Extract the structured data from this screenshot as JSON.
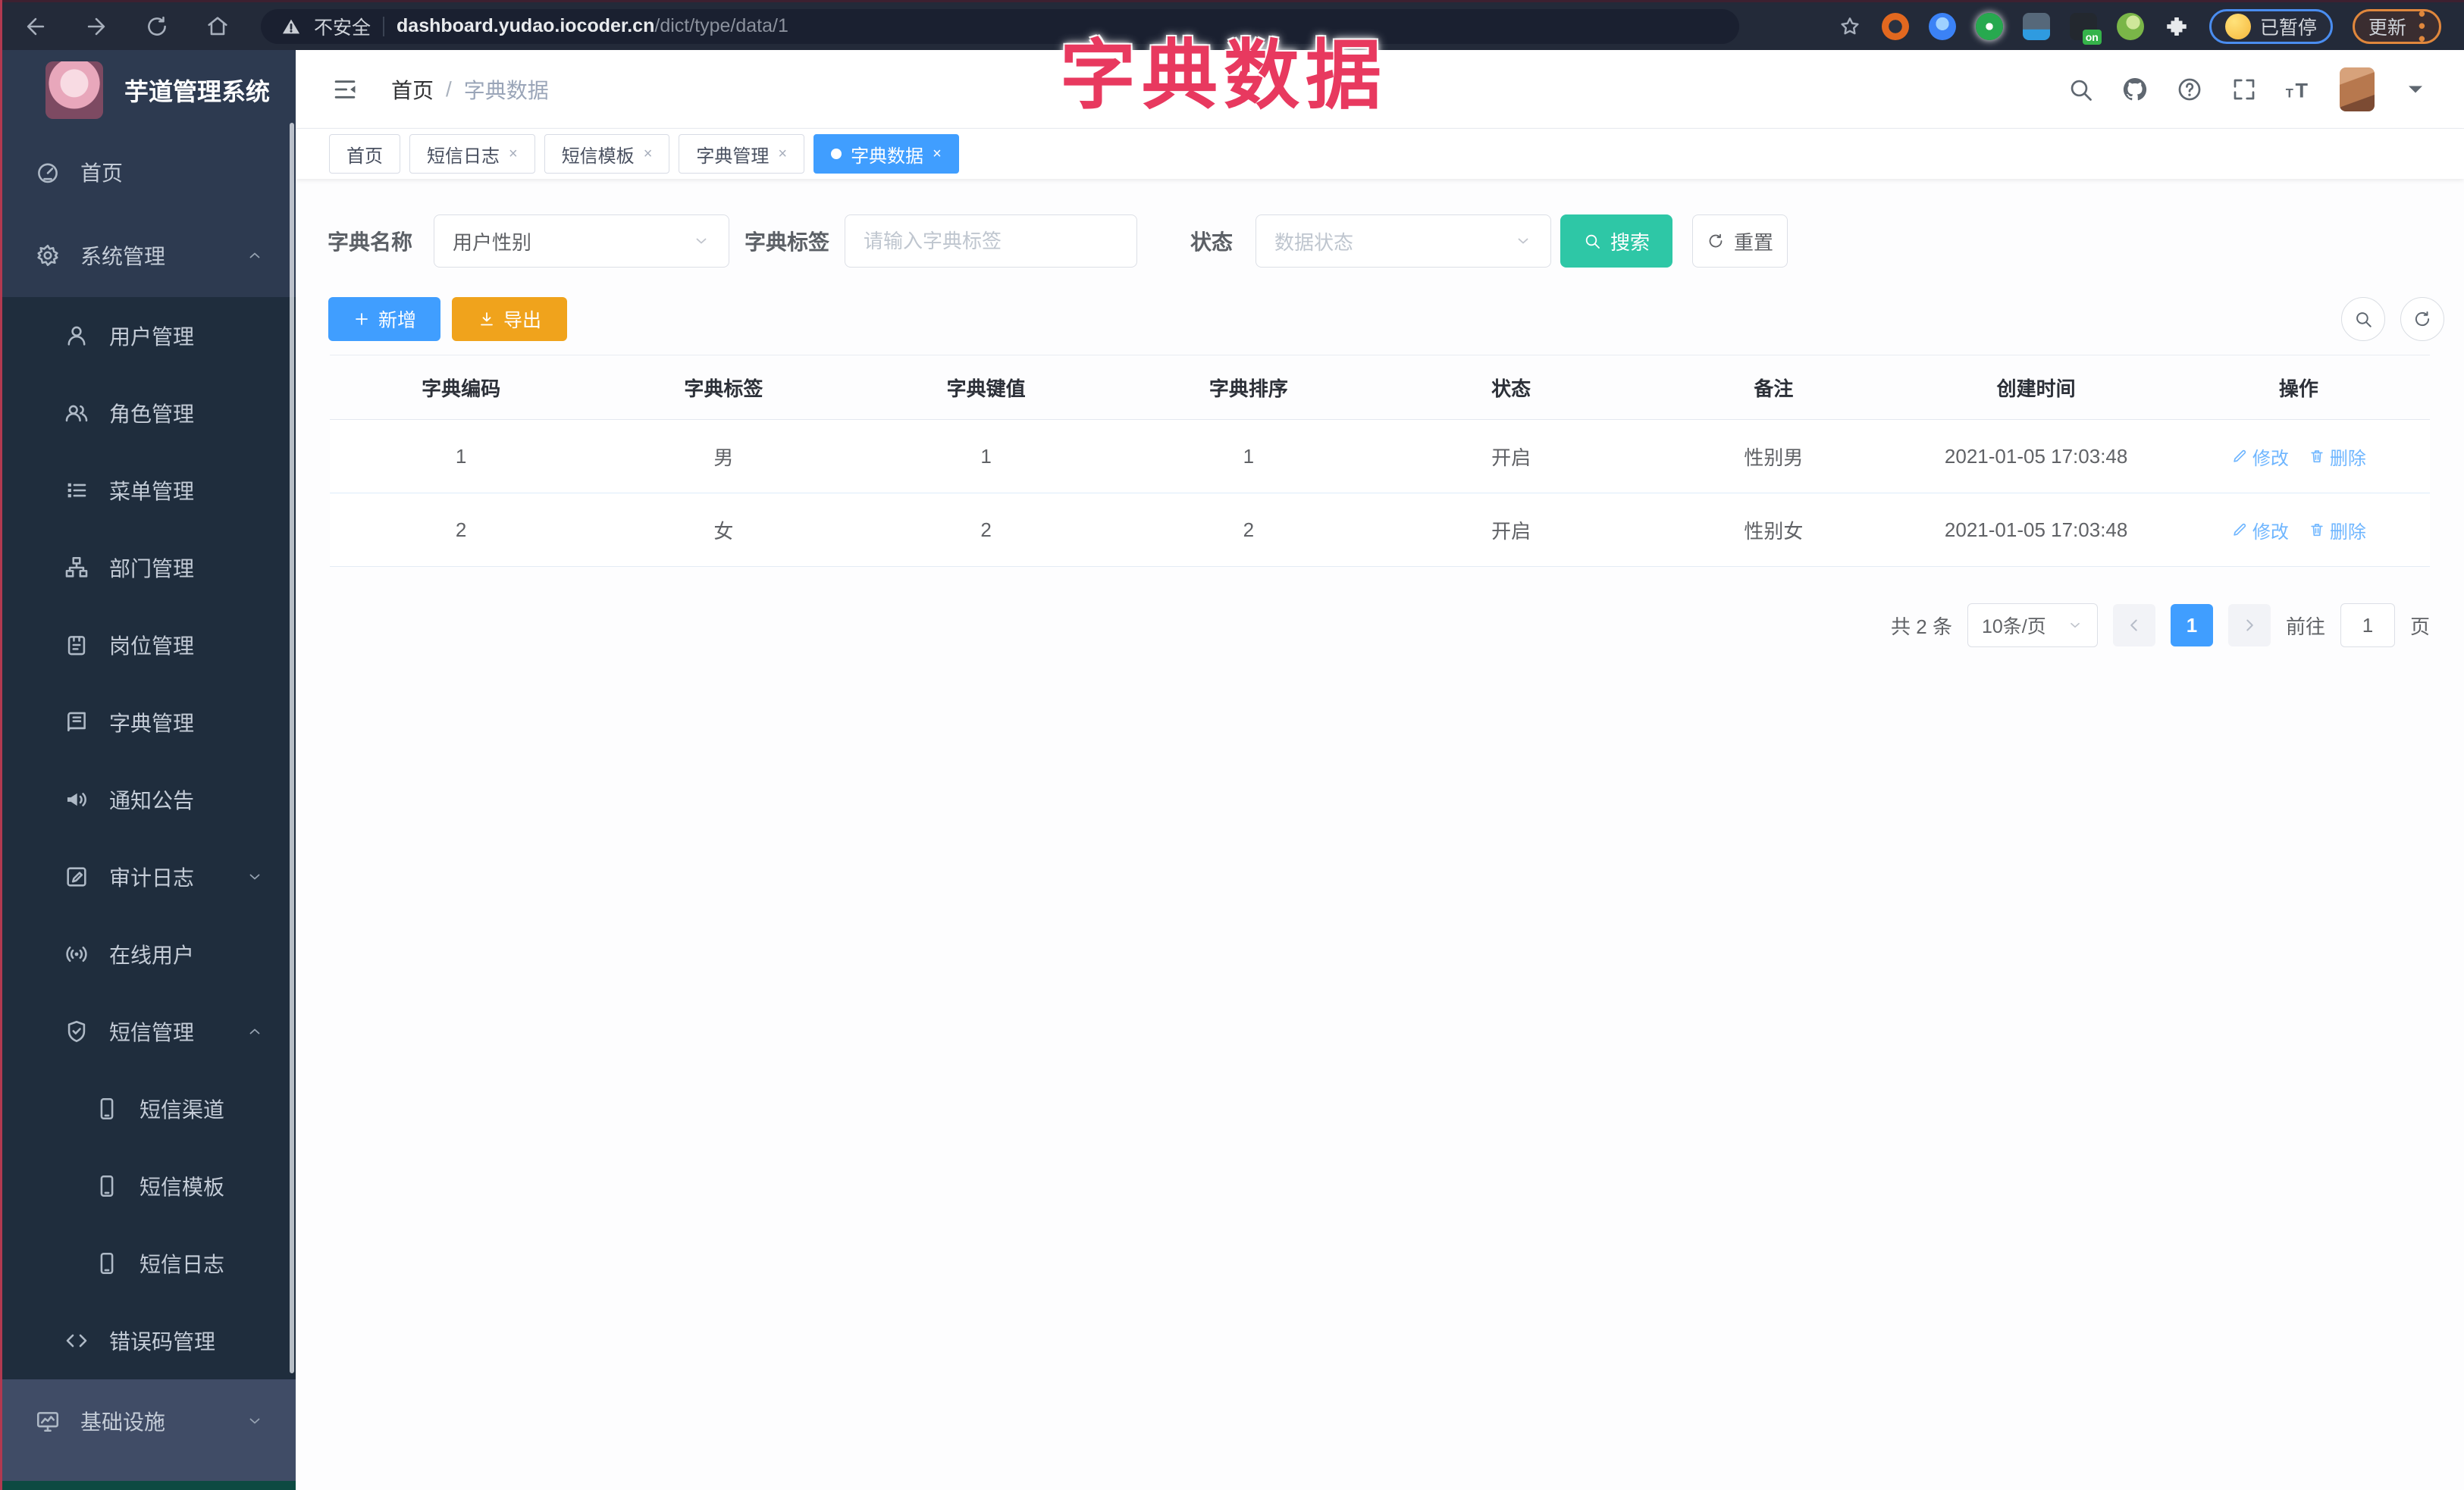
{
  "browser": {
    "insecure_label": "不安全",
    "url_domain": "dashboard.yudao.iocoder.cn",
    "url_path": "/dict/type/data/1",
    "paused_label": "已暂停",
    "update_label": "更新"
  },
  "overlay_title": "字典数据",
  "sidebar": {
    "app_title": "芋道管理系统",
    "items": [
      {
        "label": "首页",
        "icon": "dashboard-icon",
        "level": 0,
        "chevron": ""
      },
      {
        "label": "系统管理",
        "icon": "gear-icon",
        "level": 0,
        "chevron": "up"
      },
      {
        "label": "用户管理",
        "icon": "user-icon",
        "level": 1,
        "chevron": ""
      },
      {
        "label": "角色管理",
        "icon": "users-icon",
        "level": 1,
        "chevron": ""
      },
      {
        "label": "菜单管理",
        "icon": "menu-list-icon",
        "level": 1,
        "chevron": ""
      },
      {
        "label": "部门管理",
        "icon": "org-tree-icon",
        "level": 1,
        "chevron": ""
      },
      {
        "label": "岗位管理",
        "icon": "post-badge-icon",
        "level": 1,
        "chevron": ""
      },
      {
        "label": "字典管理",
        "icon": "dict-book-icon",
        "level": 1,
        "chevron": ""
      },
      {
        "label": "通知公告",
        "icon": "announcement-icon",
        "level": 1,
        "chevron": ""
      },
      {
        "label": "审计日志",
        "icon": "audit-log-icon",
        "level": 1,
        "chevron": "down"
      },
      {
        "label": "在线用户",
        "icon": "online-user-icon",
        "level": 1,
        "chevron": ""
      },
      {
        "label": "短信管理",
        "icon": "sms-shield-icon",
        "level": 1,
        "chevron": "up"
      },
      {
        "label": "短信渠道",
        "icon": "phone-icon",
        "level": 2,
        "chevron": ""
      },
      {
        "label": "短信模板",
        "icon": "phone-icon",
        "level": 2,
        "chevron": ""
      },
      {
        "label": "短信日志",
        "icon": "phone-icon",
        "level": 2,
        "chevron": ""
      },
      {
        "label": "错误码管理",
        "icon": "code-icon",
        "level": 1,
        "chevron": ""
      },
      {
        "label": "基础设施",
        "icon": "monitor-icon",
        "level": 0,
        "chevron": "down",
        "highlighted": true
      }
    ]
  },
  "header": {
    "breadcrumb": [
      "首页",
      "字典数据"
    ],
    "separator": "/"
  },
  "tabs": [
    {
      "label": "首页",
      "closable": false,
      "active": false
    },
    {
      "label": "短信日志",
      "closable": true,
      "active": false
    },
    {
      "label": "短信模板",
      "closable": true,
      "active": false
    },
    {
      "label": "字典管理",
      "closable": true,
      "active": false
    },
    {
      "label": "字典数据",
      "closable": true,
      "active": true
    }
  ],
  "filter": {
    "dict_name_label": "字典名称",
    "dict_name_value": "用户性别",
    "dict_label_label": "字典标签",
    "dict_label_placeholder": "请输入字典标签",
    "status_label": "状态",
    "status_placeholder": "数据状态",
    "search_label": "搜索",
    "reset_label": "重置"
  },
  "toolbar": {
    "add_label": "新增",
    "export_label": "导出"
  },
  "table": {
    "headers": [
      "字典编码",
      "字典标签",
      "字典键值",
      "字典排序",
      "状态",
      "备注",
      "创建时间",
      "操作"
    ],
    "rows": [
      {
        "cells": [
          "1",
          "男",
          "1",
          "1",
          "开启",
          "性别男",
          "2021-01-05 17:03:48"
        ],
        "edit_label": "修改",
        "delete_label": "删除"
      },
      {
        "cells": [
          "2",
          "女",
          "2",
          "2",
          "开启",
          "性别女",
          "2021-01-05 17:03:48"
        ],
        "edit_label": "修改",
        "delete_label": "删除"
      }
    ]
  },
  "pagination": {
    "total_label": "共 2 条",
    "page_size": "10条/页",
    "current_page": "1",
    "goto_label": "前往",
    "goto_value": "1",
    "page_unit": "页"
  },
  "colors": {
    "accent_blue": "#409eff",
    "teal": "#2ec7a6",
    "orange": "#f0a31c",
    "overlay_red": "#e8395f",
    "sidebar_bg": "#2d3a50",
    "submenu_bg": "#1f2d3d"
  }
}
